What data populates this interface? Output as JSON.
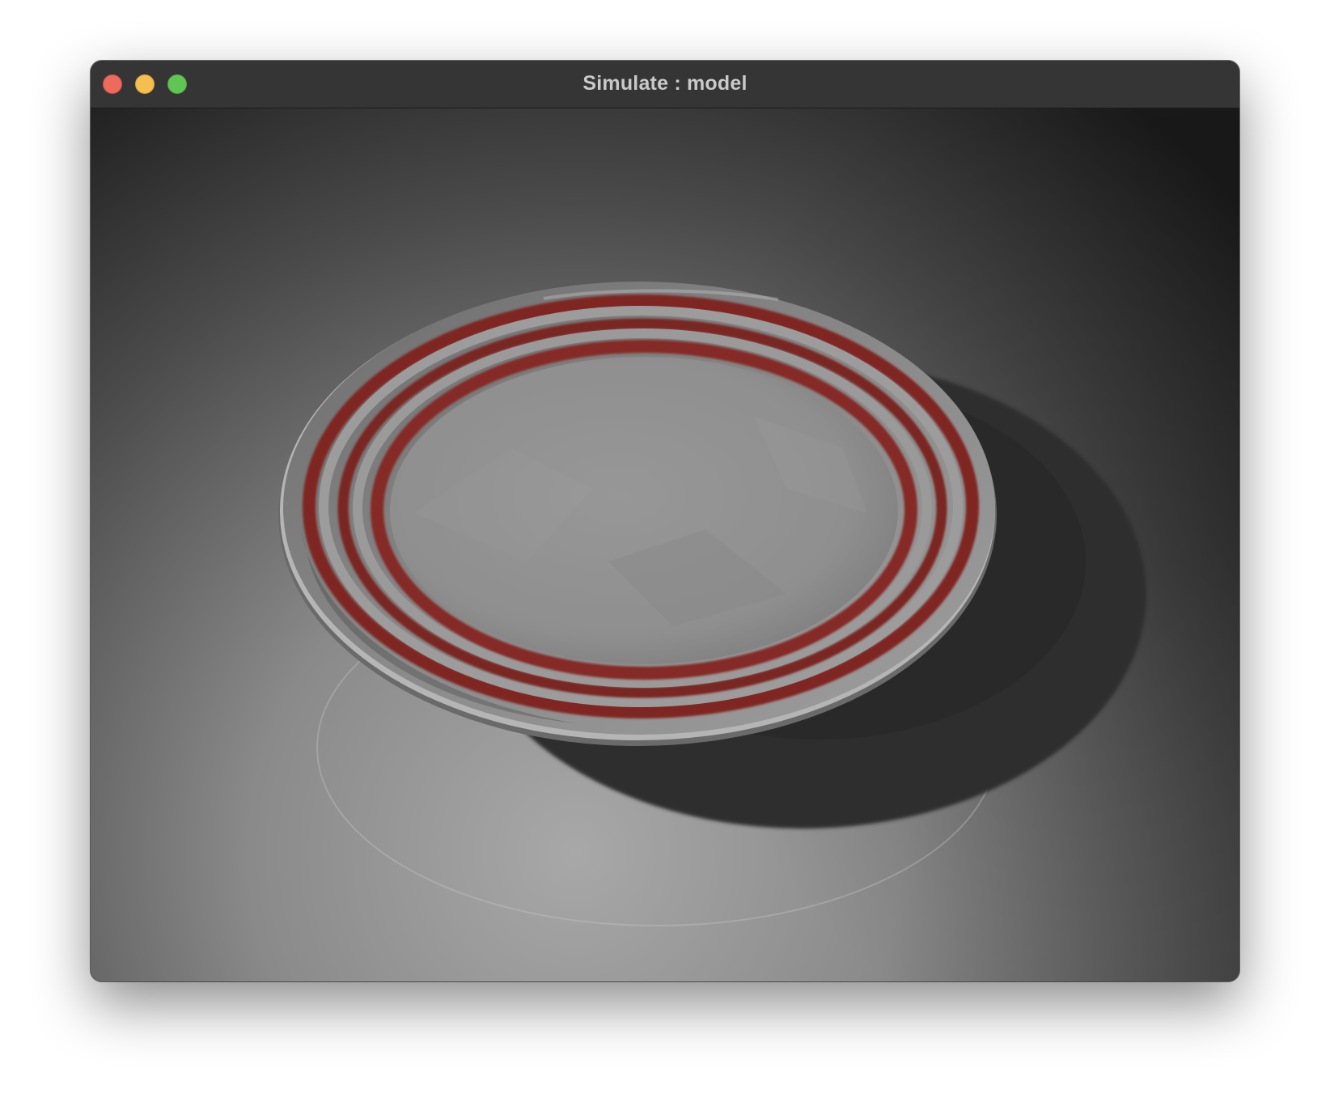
{
  "window": {
    "title": "Simulate : model"
  },
  "titlebar": {
    "buttons": [
      {
        "name": "close",
        "color": "#ed6a5e"
      },
      {
        "name": "minimize",
        "color": "#f5bf4f"
      },
      {
        "name": "maximize",
        "color": "#61c554"
      }
    ]
  },
  "viewport": {
    "object": "plate",
    "stripe_color": "#8a2a26",
    "plate_color": "#9a9a9a",
    "background_light": "#a6a6a6",
    "background_dark": "#1c1c1c"
  }
}
